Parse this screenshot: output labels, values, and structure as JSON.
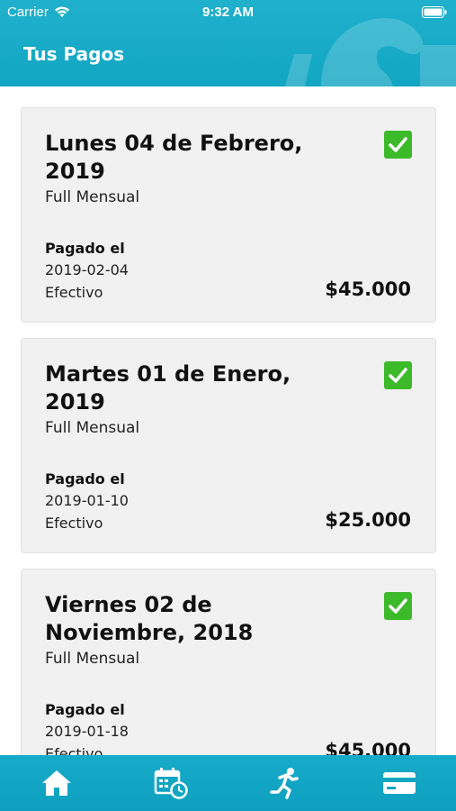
{
  "status_bar": {
    "carrier": "Carrier",
    "time": "9:32 AM"
  },
  "header": {
    "title": "Tus Pagos"
  },
  "payments": [
    {
      "date": "Lunes 04 de Febrero, 2019",
      "plan": "Full Mensual",
      "paid_label": "Pagado el",
      "paid_date": "2019-02-04",
      "method": "Efectivo",
      "amount": "$45.000"
    },
    {
      "date": "Martes 01 de Enero, 2019",
      "plan": "Full Mensual",
      "paid_label": "Pagado el",
      "paid_date": "2019-01-10",
      "method": "Efectivo",
      "amount": "$25.000"
    },
    {
      "date": "Viernes 02 de Noviembre, 2018",
      "plan": "Full Mensual",
      "paid_label": "Pagado el",
      "paid_date": "2019-01-18",
      "method": "Efectivo",
      "amount": "$45.000"
    }
  ],
  "tabbar": {
    "tabs": [
      {
        "icon": "home-icon"
      },
      {
        "icon": "calendar-clock-icon"
      },
      {
        "icon": "runner-icon"
      },
      {
        "icon": "credit-card-icon"
      }
    ]
  },
  "colors": {
    "header": "#1fb0cc",
    "check": "#3cba2a",
    "card": "#f1f1f1"
  }
}
